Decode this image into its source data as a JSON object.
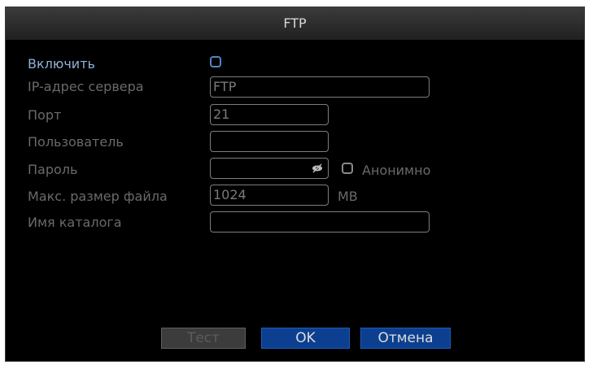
{
  "window": {
    "title": "FTP"
  },
  "form": {
    "enable_label": "Включить",
    "server_label": "IP-адрес сервера",
    "server_value": "FTP",
    "port_label": "Порт",
    "port_value": "21",
    "user_label": "Пользователь",
    "user_value": "",
    "password_label": "Пароль",
    "password_value": "",
    "anonymous_label": "Анонимно",
    "maxsize_label": "Макс. размер файла",
    "maxsize_value": "1024",
    "maxsize_unit": "MB",
    "dirname_label": "Имя каталога",
    "dirname_value": ""
  },
  "buttons": {
    "test": "Тест",
    "ok": "OK",
    "cancel": "Отмена"
  },
  "icons": {
    "password_toggle": "eye-icon"
  },
  "colors": {
    "background": "#000000",
    "active_label": "#8fb2d8",
    "button_blue": "#0c3f8f",
    "disabled_text": "#6a6a6a"
  }
}
